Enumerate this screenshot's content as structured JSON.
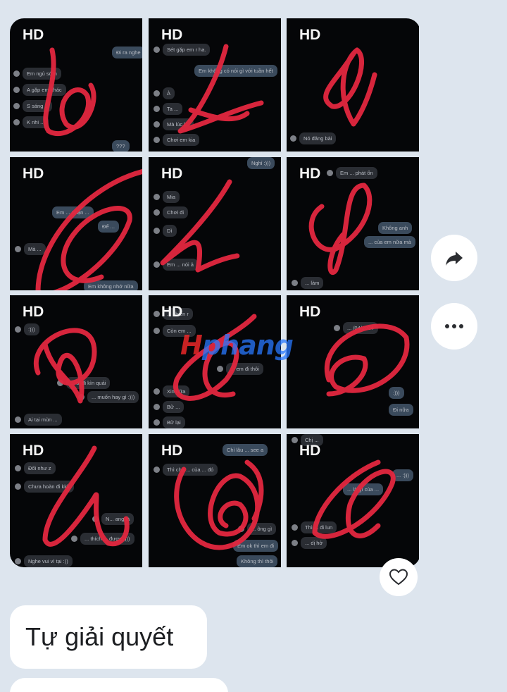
{
  "photo_grid": {
    "badge": "HD",
    "tiles": [
      {
        "lines": [
          "Đi ra nghe",
          "Em ngủ sớm",
          "A gặp em khác",
          "S sáng ..",
          "K nhi ...",
          "???"
        ]
      },
      {
        "lines": [
          "Sét gặp em r ha.",
          "Em không có nói gì với tuần hết",
          "À",
          "Ta ...",
          "Mà lúc l...",
          "Chơi em kia"
        ]
      },
      {
        "lines": [
          "Nó đăng bài"
        ]
      },
      {
        "lines": [
          "Em ... nhận ...",
          "Để ...",
          "Mà ...",
          "Em không nhớ nữa"
        ]
      },
      {
        "lines": [
          "Nghỉ :)))",
          "Mia",
          "Chơi đi",
          "Dì",
          "Em ... nói ả"
        ]
      },
      {
        "lines": [
          "Em ... phát ổn",
          "Không anh",
          "... của em nữa mà",
          "... làm"
        ]
      },
      {
        "lines": [
          ":)))",
          "... sĩ đi kìn quải",
          "... muốn hay gì :)))",
          "Ai tại mùn ..."
        ]
      },
      {
        "lines": [
          "... chiến r",
          "Còn em ...",
          "... em đi thôi",
          "Xin nữa",
          "Bữ ...",
          "Bữ lại"
        ]
      },
      {
        "lines": [
          "... /04/2024",
          "Đi nữa",
          ":)))"
        ]
      },
      {
        "lines": [
          "Đổi như z",
          "Chưa hoàn đi kkk",
          "N... ang là",
          "... thích ... được :)))",
          "Nghe vui vì tại :))"
        ]
      },
      {
        "lines": [
          "Chỉ lâu ... see a",
          "Thì chả ... của ... đó",
          "... ông gì",
          "Em ok thì em đi",
          "Không thì thôi"
        ]
      },
      {
        "lines": [
          "Chị ... ",
          "... là gì của ...",
          "... :)))",
          "Thì ... đi lun",
          "... dị hở"
        ]
      }
    ]
  },
  "watermark": {
    "part1": "H",
    "part2": "phang"
  },
  "actions": {
    "share_icon": "share-arrow-icon",
    "more_icon": "more-dots-icon",
    "react_icon": "heart-outline-icon"
  },
  "message": {
    "text": "Tự giải quyết"
  },
  "colors": {
    "background": "#dde5ee",
    "scribble": "#e3273f",
    "bubble": "#ffffff"
  }
}
